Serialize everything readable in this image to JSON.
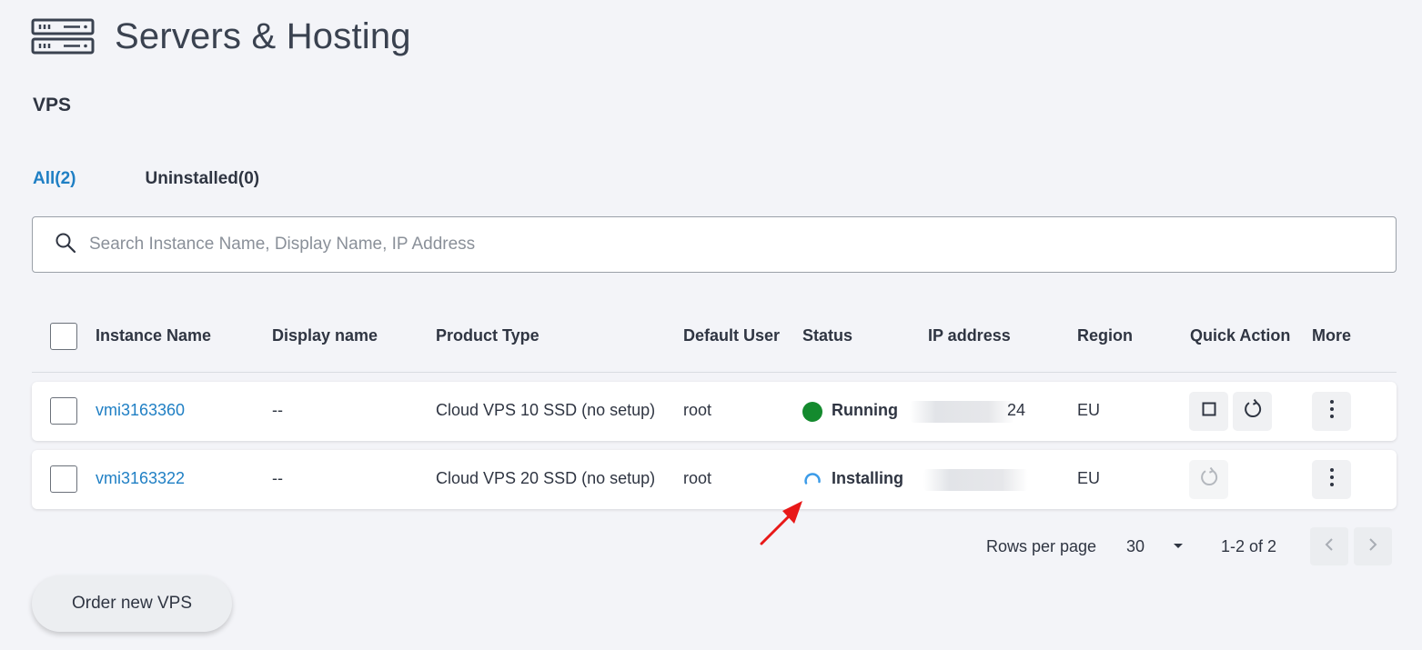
{
  "header": {
    "title": "Servers & Hosting",
    "icon": "server-rack-icon"
  },
  "section": {
    "title": "VPS"
  },
  "tabs": [
    {
      "label": "All(2)",
      "active": true
    },
    {
      "label": "Uninstalled(0)",
      "active": false
    }
  ],
  "search": {
    "placeholder": "Search Instance Name, Display Name, IP Address",
    "value": ""
  },
  "table": {
    "columns": [
      "Instance Name",
      "Display name",
      "Product Type",
      "Default User",
      "Status",
      "IP address",
      "Region",
      "Quick Action",
      "More"
    ],
    "rows": [
      {
        "instance_name": "vmi3163360",
        "display_name": "--",
        "product_type": "Cloud VPS 10 SSD (no setup)",
        "default_user": "root",
        "status": "Running",
        "ip_suffix": "24",
        "region": "EU"
      },
      {
        "instance_name": "vmi3163322",
        "display_name": "--",
        "product_type": "Cloud VPS 20 SSD (no setup)",
        "default_user": "root",
        "status": "Installing",
        "region": "EU"
      }
    ]
  },
  "pagination": {
    "rows_per_page_label": "Rows per page",
    "rows_per_page": "30",
    "range": "1-2 of 2"
  },
  "actions": {
    "order_label": "Order new VPS"
  },
  "colors": {
    "accent": "#1f7fc4",
    "running": "#148a2e",
    "installing": "#3b9be8",
    "annotation": "#e81818"
  }
}
